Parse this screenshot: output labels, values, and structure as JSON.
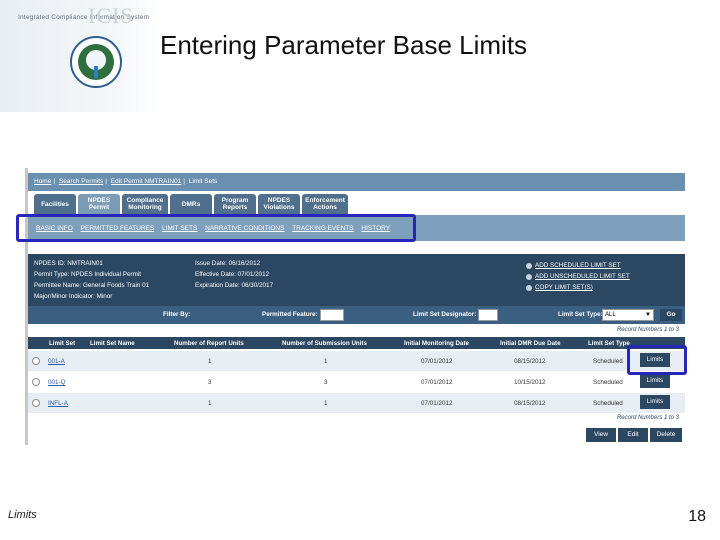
{
  "slide": {
    "title": "Entering Parameter Base Limits",
    "logo_text": "ICIS",
    "logo_subtitle": "Integrated Compliance Information System",
    "footer_left": "Limits",
    "page_number": "18"
  },
  "app": {
    "breadcrumb": [
      "Home",
      "Search Permits",
      "Edit Permit NMTRAIN01",
      "Limit Sets"
    ],
    "tabs": [
      {
        "label": "Facilities",
        "active": false
      },
      {
        "label": "NPDES Permit",
        "active": true
      },
      {
        "label": "Compliance Monitoring",
        "active": false
      },
      {
        "label": "DMRs",
        "active": false
      },
      {
        "label": "Program Reports",
        "active": false
      },
      {
        "label": "NPDES Violations",
        "active": false
      },
      {
        "label": "Enforcement Actions",
        "active": false
      }
    ],
    "subnav": [
      "BASIC INFO",
      "PERMITTED FEATURES",
      "LIMIT SETS",
      "NARRATIVE CONDITIONS",
      "TRACKING EVENTS",
      "HISTORY"
    ],
    "info": {
      "npdes_id": "NPDES ID: NMTRAIN01",
      "permit_type": "Permit Type: NPDES Individual Permit",
      "permittee": "Permittee Name: General Foods Train 01",
      "major_minor": "Major/Minor Indicator: Minor",
      "issue_date": "Issue Date: 06/16/2012",
      "effective_date": "Effective Date: 07/01/2012",
      "expiration_date": "Expiration Date: 06/30/2017",
      "actions": [
        "ADD SCHEDULED LIMIT SET",
        "ADD UNSCHEDULED LIMIT SET",
        "COPY LIMIT SET(S)"
      ]
    },
    "filter": {
      "filter_by": "Filter By:",
      "permitted_feature": "Permitted Feature:",
      "limit_set_designator": "Limit Set Designator:",
      "limit_set_type": "Limit Set Type:",
      "limit_set_type_value": "ALL",
      "go": "Go"
    },
    "records_label": "Record Numbers 1 to 3",
    "table": {
      "headers": [
        "Limit Set",
        "Limit Set Name",
        "Number of Report Units",
        "Number of Submission Units",
        "Initial Monitoring Date",
        "Initial DMR Due Date",
        "Limit Set Type"
      ],
      "rows": [
        {
          "limit_set": "001-A",
          "name": "",
          "report_units": "1",
          "submission_units": "1",
          "monitoring_date": "07/01/2012",
          "dmr_due": "08/15/2012",
          "type": "Scheduled",
          "button": "Limits"
        },
        {
          "limit_set": "001-Q",
          "name": "",
          "report_units": "3",
          "submission_units": "3",
          "monitoring_date": "07/01/2012",
          "dmr_due": "10/15/2012",
          "type": "Scheduled",
          "button": "Limits"
        },
        {
          "limit_set": "INFL-A",
          "name": "",
          "report_units": "1",
          "submission_units": "1",
          "monitoring_date": "07/01/2012",
          "dmr_due": "08/15/2012",
          "type": "Scheduled",
          "button": "Limits"
        }
      ]
    },
    "buttons": {
      "view": "View",
      "edit": "Edit",
      "delete": "Delete"
    }
  },
  "colors": {
    "highlight": "#2626b8",
    "nav_dark": "#2c4761",
    "link": "#2a5ea8"
  }
}
